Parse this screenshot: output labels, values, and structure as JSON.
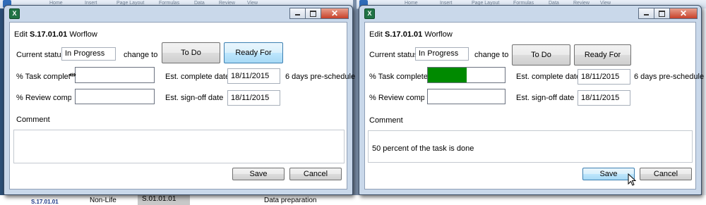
{
  "background": {
    "ribbon_tabs": [
      "Home",
      "Insert",
      "Page Layout",
      "Formulas",
      "Data",
      "Review",
      "View"
    ],
    "cells": {
      "left_code": "S.17.01.01",
      "left_desc": "Non-Life",
      "middle_code": "S.01.01.01",
      "middle_desc": "Data preparation"
    }
  },
  "left": {
    "title_prefix": "Edit",
    "title_code": "S.17.01.01",
    "title_suffix": "Worflow",
    "current_status_label": "Current status",
    "current_status_value": "In Progress",
    "change_to_label": "change to",
    "todo_button": "To Do",
    "ready_button": "Ready For Review",
    "task_complete_label": "% Task complete",
    "task_complete_value": "",
    "task_progress": 0,
    "review_complete_label": "% Review complete",
    "review_complete_value": "",
    "est_complete_label": "Est. complete date",
    "est_complete_value": "18/11/2015",
    "schedule_note": "6 days pre-schedule",
    "est_signoff_label": "Est. sign-off date",
    "est_signoff_value": "18/11/2015",
    "comment_label": "Comment",
    "comment_text": "",
    "save_button": "Save",
    "cancel_button": "Cancel"
  },
  "right": {
    "title_prefix": "Edit",
    "title_code": "S.17.01.01",
    "title_suffix": "Worflow",
    "current_status_label": "Current status",
    "current_status_value": "In Progress",
    "change_to_label": "change to",
    "todo_button": "To Do",
    "ready_button": "Ready For Review",
    "task_complete_label": "% Task complete",
    "task_progress": 0.5,
    "review_complete_label": "% Review complete",
    "review_complete_value": "",
    "est_complete_label": "Est. complete date",
    "est_complete_value": "18/11/2015",
    "schedule_note": "6 days pre-schedule",
    "est_signoff_label": "Est. sign-off date",
    "est_signoff_value": "18/11/2015",
    "comment_label": "Comment",
    "comment_text": "50 percent of the task is done",
    "save_button": "Save",
    "cancel_button": "Cancel"
  },
  "colors": {
    "progress_fill": "#008a00",
    "dialog_frame": "#c9d8ea",
    "close_button": "#c7412a"
  },
  "icons": [
    "excel-icon",
    "minimize-icon",
    "maximize-icon",
    "close-icon",
    "resize-cursor-icon",
    "mouse-pointer-icon"
  ]
}
